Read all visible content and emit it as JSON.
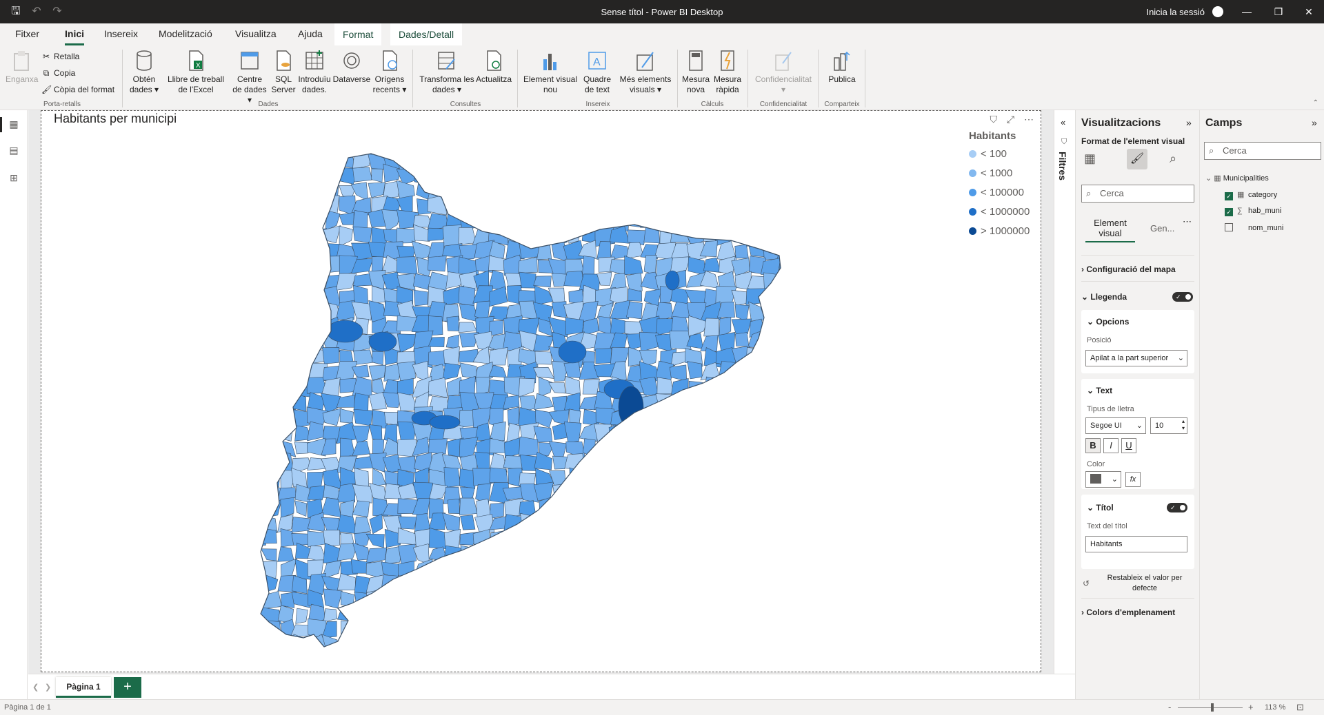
{
  "window": {
    "title": "Sense títol - Power BI Desktop",
    "signin": "Inicia la sessió"
  },
  "menu": {
    "tabs": [
      "Fitxer",
      "Inici",
      "Insereix",
      "Modelització",
      "Visualitza",
      "Ajuda",
      "Format",
      "Dades/Detall"
    ]
  },
  "ribbon": {
    "clipboard": {
      "paste": "Enganxa",
      "cut": "Retalla",
      "copy": "Copia",
      "format_painter": "Còpia del format",
      "group": "Porta-retalls"
    },
    "data": {
      "get_data": "Obtén dades",
      "excel": "Llibre de treball de l'Excel",
      "hub": "Centre de dades",
      "sql": "SQL Server",
      "enter": "Introduïu dades.",
      "dataverse": "Dataverse",
      "recent": "Orígens recents",
      "group": "Dades"
    },
    "queries": {
      "transform": "Transforma les dades",
      "refresh": "Actualitza",
      "group": "Consultes"
    },
    "insert": {
      "new_visual": "Element visual nou",
      "text_box": "Quadre de text",
      "more_visuals": "Més elements visuals",
      "group": "Insereix"
    },
    "calc": {
      "new_measure": "Mesura nova",
      "quick_measure": "Mesura ràpida",
      "group": "Càlculs"
    },
    "sensitivity": {
      "label": "Confidencialitat",
      "group": "Confidencialitat"
    },
    "share": {
      "publish": "Publica",
      "group": "Comparteix"
    }
  },
  "visual": {
    "title": "Habitants per municipi",
    "legend_title": "Habitants",
    "legend": [
      {
        "label": "< 100",
        "color": "#a7cdf5"
      },
      {
        "label": "< 1000",
        "color": "#82b8ef"
      },
      {
        "label": "< 100000",
        "color": "#4f9be8"
      },
      {
        "label": "< 1000000",
        "color": "#1f6fc7"
      },
      {
        "label": "> 1000000",
        "color": "#0b4a94"
      }
    ]
  },
  "pages": {
    "tab": "Pàgina 1",
    "add": "+",
    "status": "Pàgina 1 de 1",
    "zoom": "113 %"
  },
  "filters": {
    "label": "Filtres"
  },
  "viz": {
    "title": "Visualitzacions",
    "format_label": "Format de l'element visual",
    "search": "Cerca",
    "tab_visual": "Element visual",
    "tab_general": "Gen...",
    "map_config": "Configuració del mapa",
    "legend": "Llegenda",
    "options": "Opcions",
    "position_label": "Posició",
    "position_value": "Apilat a la part superior",
    "text": "Text",
    "font_label": "Tipus de lletra",
    "font_value": "Segoe UI",
    "font_size": "10",
    "bold": "B",
    "italic": "I",
    "underline": "U",
    "color_label": "Color",
    "fx": "fx",
    "title_section": "Títol",
    "title_text_label": "Text del títol",
    "title_text_value": "Habitants",
    "reset": "Restableix el valor per defecte",
    "fill_colors": "Colors d'emplenament"
  },
  "fields": {
    "title": "Camps",
    "search": "Cerca",
    "table": "Municipalities",
    "items": [
      {
        "name": "category",
        "checked": true
      },
      {
        "name": "hab_muni",
        "checked": true
      },
      {
        "name": "nom_muni",
        "checked": false
      }
    ]
  }
}
